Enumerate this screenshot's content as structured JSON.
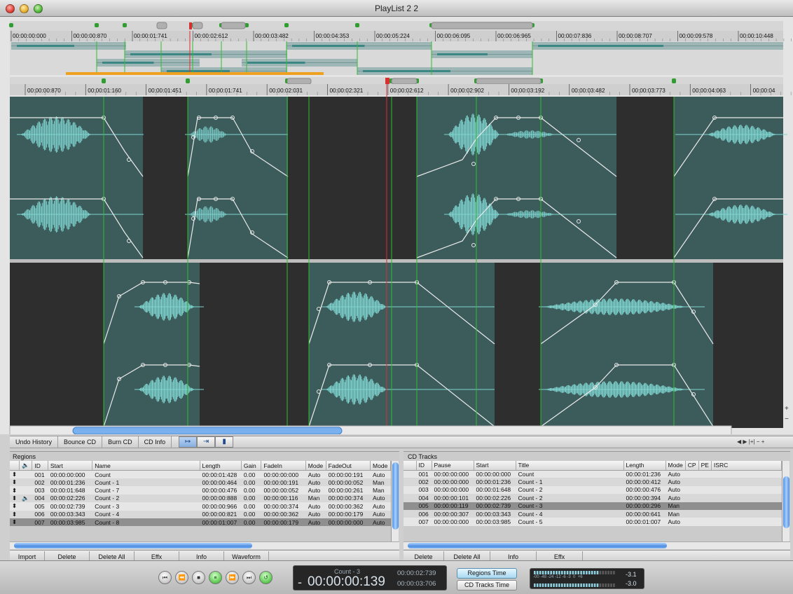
{
  "window": {
    "title": "PlayList 2 2"
  },
  "overview_ruler": {
    "ticks": [
      "00:00:00:000",
      "00:00:00:870",
      "00:00:01:741",
      "00:00:02:612",
      "00:00:03:482",
      "00:00:04:353",
      "00:00:05:224",
      "00:00:06:095",
      "00:00:06:965",
      "00:00:07:836",
      "00:00:08:707",
      "00:00:09:578",
      "00:00:10:448"
    ]
  },
  "main_ruler": {
    "ticks": [
      "00:00:00:870",
      "00:00:01:160",
      "00:00:01:451",
      "00:00:01:741",
      "00:00:02:031",
      "00:00:02:321",
      "00:00:02:612",
      "00:00:02:902",
      "00:00:03:192",
      "00:00:03:482",
      "00:00:03:773",
      "00:00:04:063",
      "00:00:04"
    ]
  },
  "editor_toolbar": {
    "buttons": [
      "Undo History",
      "Bounce CD",
      "Burn CD",
      "CD Info"
    ]
  },
  "regions": {
    "title": "Regions",
    "columns": [
      "ID",
      "Start",
      "Name",
      "Length",
      "Gain",
      "FadeIn",
      "Mode",
      "FadeOut",
      "Mode"
    ],
    "rows": [
      {
        "id": "001",
        "start": "00:00:00:000",
        "name": "Count",
        "length": "00:00:01:428",
        "gain": "0.00",
        "fadein": "00:00:00:000",
        "mode1": "Auto",
        "fadeout": "00:00:00:191",
        "mode2": "Auto"
      },
      {
        "id": "002",
        "start": "00:00:01:236",
        "name": "Count - 1",
        "length": "00:00:00:464",
        "gain": "0.00",
        "fadein": "00:00:00:191",
        "mode1": "Auto",
        "fadeout": "00:00:00:052",
        "mode2": "Man"
      },
      {
        "id": "003",
        "start": "00:00:01:648",
        "name": "Count - 7",
        "length": "00:00:00:476",
        "gain": "0.00",
        "fadein": "00:00:00:052",
        "mode1": "Auto",
        "fadeout": "00:00:00:261",
        "mode2": "Man"
      },
      {
        "id": "004",
        "start": "00:00:02:226",
        "name": "Count - 2",
        "length": "00:00:00:888",
        "gain": "0.00",
        "fadein": "00:00:00:116",
        "mode1": "Man",
        "fadeout": "00:00:00:374",
        "mode2": "Auto"
      },
      {
        "id": "005",
        "start": "00:00:02:739",
        "name": "Count - 3",
        "length": "00:00:00:966",
        "gain": "0.00",
        "fadein": "00:00:00:374",
        "mode1": "Auto",
        "fadeout": "00:00:00:362",
        "mode2": "Auto"
      },
      {
        "id": "006",
        "start": "00:00:03:343",
        "name": "Count - 4",
        "length": "00:00:00:821",
        "gain": "0.00",
        "fadein": "00:00:00:362",
        "mode1": "Auto",
        "fadeout": "00:00:00:179",
        "mode2": "Auto"
      },
      {
        "id": "007",
        "start": "00:00:03:985",
        "name": "Count - 8",
        "length": "00:00:01:007",
        "gain": "0.00",
        "fadein": "00:00:00:179",
        "mode1": "Auto",
        "fadeout": "00:00:00:000",
        "mode2": "Auto"
      }
    ],
    "buttons": [
      "Import",
      "Delete",
      "Delete All",
      "Effx",
      "Info",
      "Waveform"
    ]
  },
  "cd_tracks": {
    "title": "CD Tracks",
    "columns": [
      "ID",
      "Pause",
      "Start",
      "Title",
      "Length",
      "Mode",
      "CP",
      "PE",
      "ISRC"
    ],
    "rows": [
      {
        "id": "001",
        "pause": "00:00:00:000",
        "start": "00:00:00:000",
        "title": "Count",
        "length": "00:00:01:236",
        "mode": "Auto"
      },
      {
        "id": "002",
        "pause": "00:00:00:000",
        "start": "00:00:01:236",
        "title": "Count - 1",
        "length": "00:00:00:412",
        "mode": "Auto"
      },
      {
        "id": "003",
        "pause": "00:00:00:000",
        "start": "00:00:01:648",
        "title": "Count - 2",
        "length": "00:00:00:476",
        "mode": "Auto"
      },
      {
        "id": "004",
        "pause": "00:00:00:101",
        "start": "00:00:02:226",
        "title": "Count - 2",
        "length": "00:00:00:394",
        "mode": "Auto"
      },
      {
        "id": "005",
        "pause": "00:00:00:119",
        "start": "00:00:02:739",
        "title": "Count - 3",
        "length": "00:00:00:296",
        "mode": "Man"
      },
      {
        "id": "006",
        "pause": "00:00:00:307",
        "start": "00:00:03:343",
        "title": "Count - 4",
        "length": "00:00:00:641",
        "mode": "Man"
      },
      {
        "id": "007",
        "pause": "00:00:00:000",
        "start": "00:00:03:985",
        "title": "Count - 5",
        "length": "00:00:01:007",
        "mode": "Auto"
      }
    ],
    "buttons": [
      "Delete",
      "Delete All",
      "Info",
      "Effx"
    ]
  },
  "transport": {
    "track_name": "Count - 3",
    "main_time": "00:00:00:139",
    "main_sign": "-",
    "time_a": "00:00:02:739",
    "time_b": "00:00:03:706",
    "regions_time_label": "Regions Time",
    "cd_tracks_time_label": "CD Tracks Time",
    "meter_scale": "-00 -48 -24 -12 -6 -3  0  +6",
    "level_left": "-3.1",
    "level_right": "-3.0"
  },
  "colors": {
    "region_fill": "#3c5b5b",
    "waveform": "#7fd4d0",
    "edit_line": "#2fbf2f",
    "playhead": "#d83030",
    "overview_bar": "#f0a020"
  }
}
